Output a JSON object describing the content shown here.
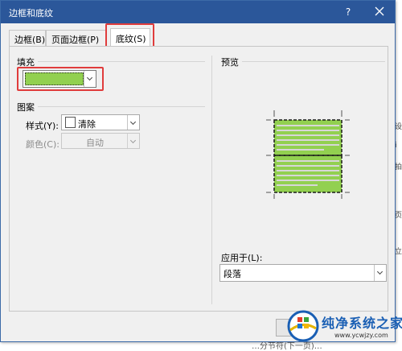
{
  "dialog": {
    "title": "边框和底纹",
    "help": "?"
  },
  "tabs": [
    {
      "label": "边框(B)",
      "active": false
    },
    {
      "label": "页面边框(P)",
      "active": false
    },
    {
      "label": "底纹(S)",
      "active": true
    }
  ],
  "fill": {
    "section_label": "填充",
    "color": "#92d050"
  },
  "pattern": {
    "section_label": "图案",
    "style_label": "样式(Y):",
    "style_value": "清除",
    "color_label": "颜色(C):",
    "color_value": "自动"
  },
  "preview": {
    "section_label": "预览"
  },
  "apply_to": {
    "label": "应用于(L):",
    "value": "段落"
  },
  "background": {
    "right_margin_chars": [
      "设",
      "i",
      "拍",
      "页",
      "立"
    ],
    "bottom_text": "…分节符(下一页)…"
  },
  "watermark": {
    "title": "纯净系统之家",
    "url": "www.ycwjzy.com"
  },
  "colors": {
    "titlebar": "#2b579a",
    "highlight": "#e03c3c",
    "fill_green": "#92d050"
  }
}
